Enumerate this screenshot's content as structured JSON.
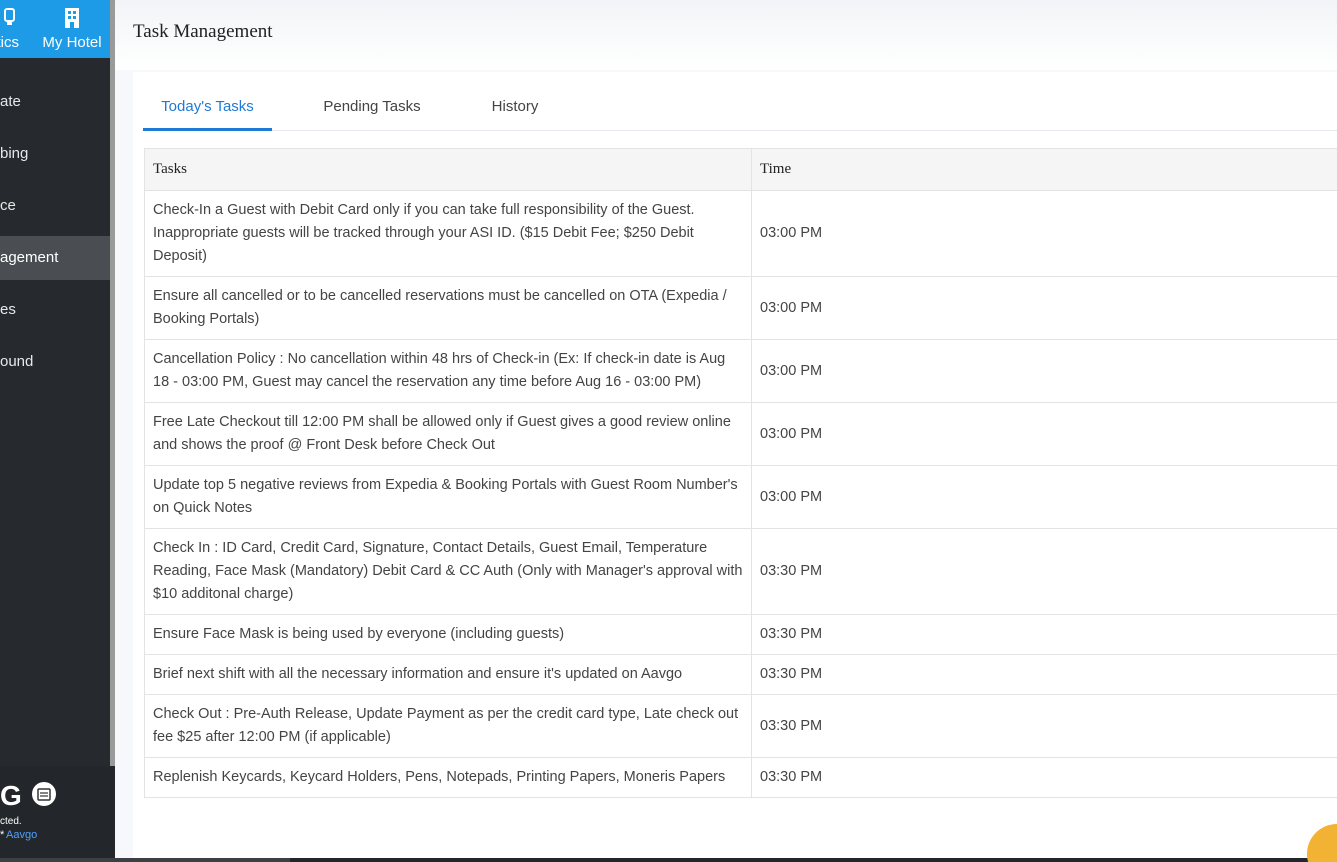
{
  "sidebar": {
    "top_buttons": [
      {
        "label": "ytics",
        "icon": "analytics-icon"
      },
      {
        "label": "My Hotel",
        "icon": "hotel-building-icon"
      }
    ],
    "items": [
      {
        "label": "ate"
      },
      {
        "label": "bing"
      },
      {
        "label": "ce"
      },
      {
        "label": "agement"
      },
      {
        "label": "es"
      },
      {
        "label": "ound"
      }
    ],
    "active_index": 3,
    "footer": {
      "logo_letter": "G",
      "text": "cted.",
      "star": "*",
      "link": "Aavgo"
    }
  },
  "header": {
    "title": "Task Management"
  },
  "tabs": [
    {
      "label": "Today's Tasks",
      "active": true
    },
    {
      "label": "Pending Tasks",
      "active": false
    },
    {
      "label": "History",
      "active": false
    }
  ],
  "table": {
    "columns": [
      "Tasks",
      "Time"
    ],
    "rows": [
      {
        "task": "Check-In a Guest with Debit Card only if you can take full responsibility of the Guest. Inappropriate guests will be tracked through your ASI ID. ($15 Debit Fee; $250 Debit Deposit)",
        "time": "03:00 PM"
      },
      {
        "task": "Ensure all cancelled or to be cancelled reservations must be cancelled on OTA (Expedia / Booking Portals)",
        "time": "03:00 PM"
      },
      {
        "task": "Cancellation Policy : No cancellation within 48 hrs of Check-in (Ex: If check-in date is Aug 18 - 03:00 PM, Guest may cancel the reservation any time before Aug 16 - 03:00 PM)",
        "time": "03:00 PM"
      },
      {
        "task": "Free Late Checkout till 12:00 PM shall be allowed only if Guest gives a good review online and shows the proof @ Front Desk before Check Out",
        "time": "03:00 PM"
      },
      {
        "task": "Update top 5 negative reviews from Expedia & Booking Portals with Guest Room Number's on Quick Notes",
        "time": "03:00 PM"
      },
      {
        "task": "Check In : ID Card, Credit Card, Signature, Contact Details, Guest Email, Temperature Reading, Face Mask (Mandatory) Debit Card & CC Auth (Only with Manager's approval with $10 additonal charge)",
        "time": "03:30 PM"
      },
      {
        "task": "Ensure Face Mask is being used by everyone (including guests)",
        "time": "03:30 PM"
      },
      {
        "task": "Brief next shift with all the necessary information and ensure it's updated on Aavgo",
        "time": "03:30 PM"
      },
      {
        "task": "Check Out : Pre-Auth Release, Update Payment as per the credit card type, Late check out fee $25 after 12:00 PM (if applicable)",
        "time": "03:30 PM"
      },
      {
        "task": "Replenish Keycards, Keycard Holders, Pens, Notepads, Printing Papers, Moneris Papers",
        "time": "03:30 PM"
      }
    ]
  },
  "colors": {
    "accent": "#1f7ad6",
    "top_nav": "#1e9be6",
    "sidebar": "#262a2e",
    "fab": "#f2b233"
  }
}
